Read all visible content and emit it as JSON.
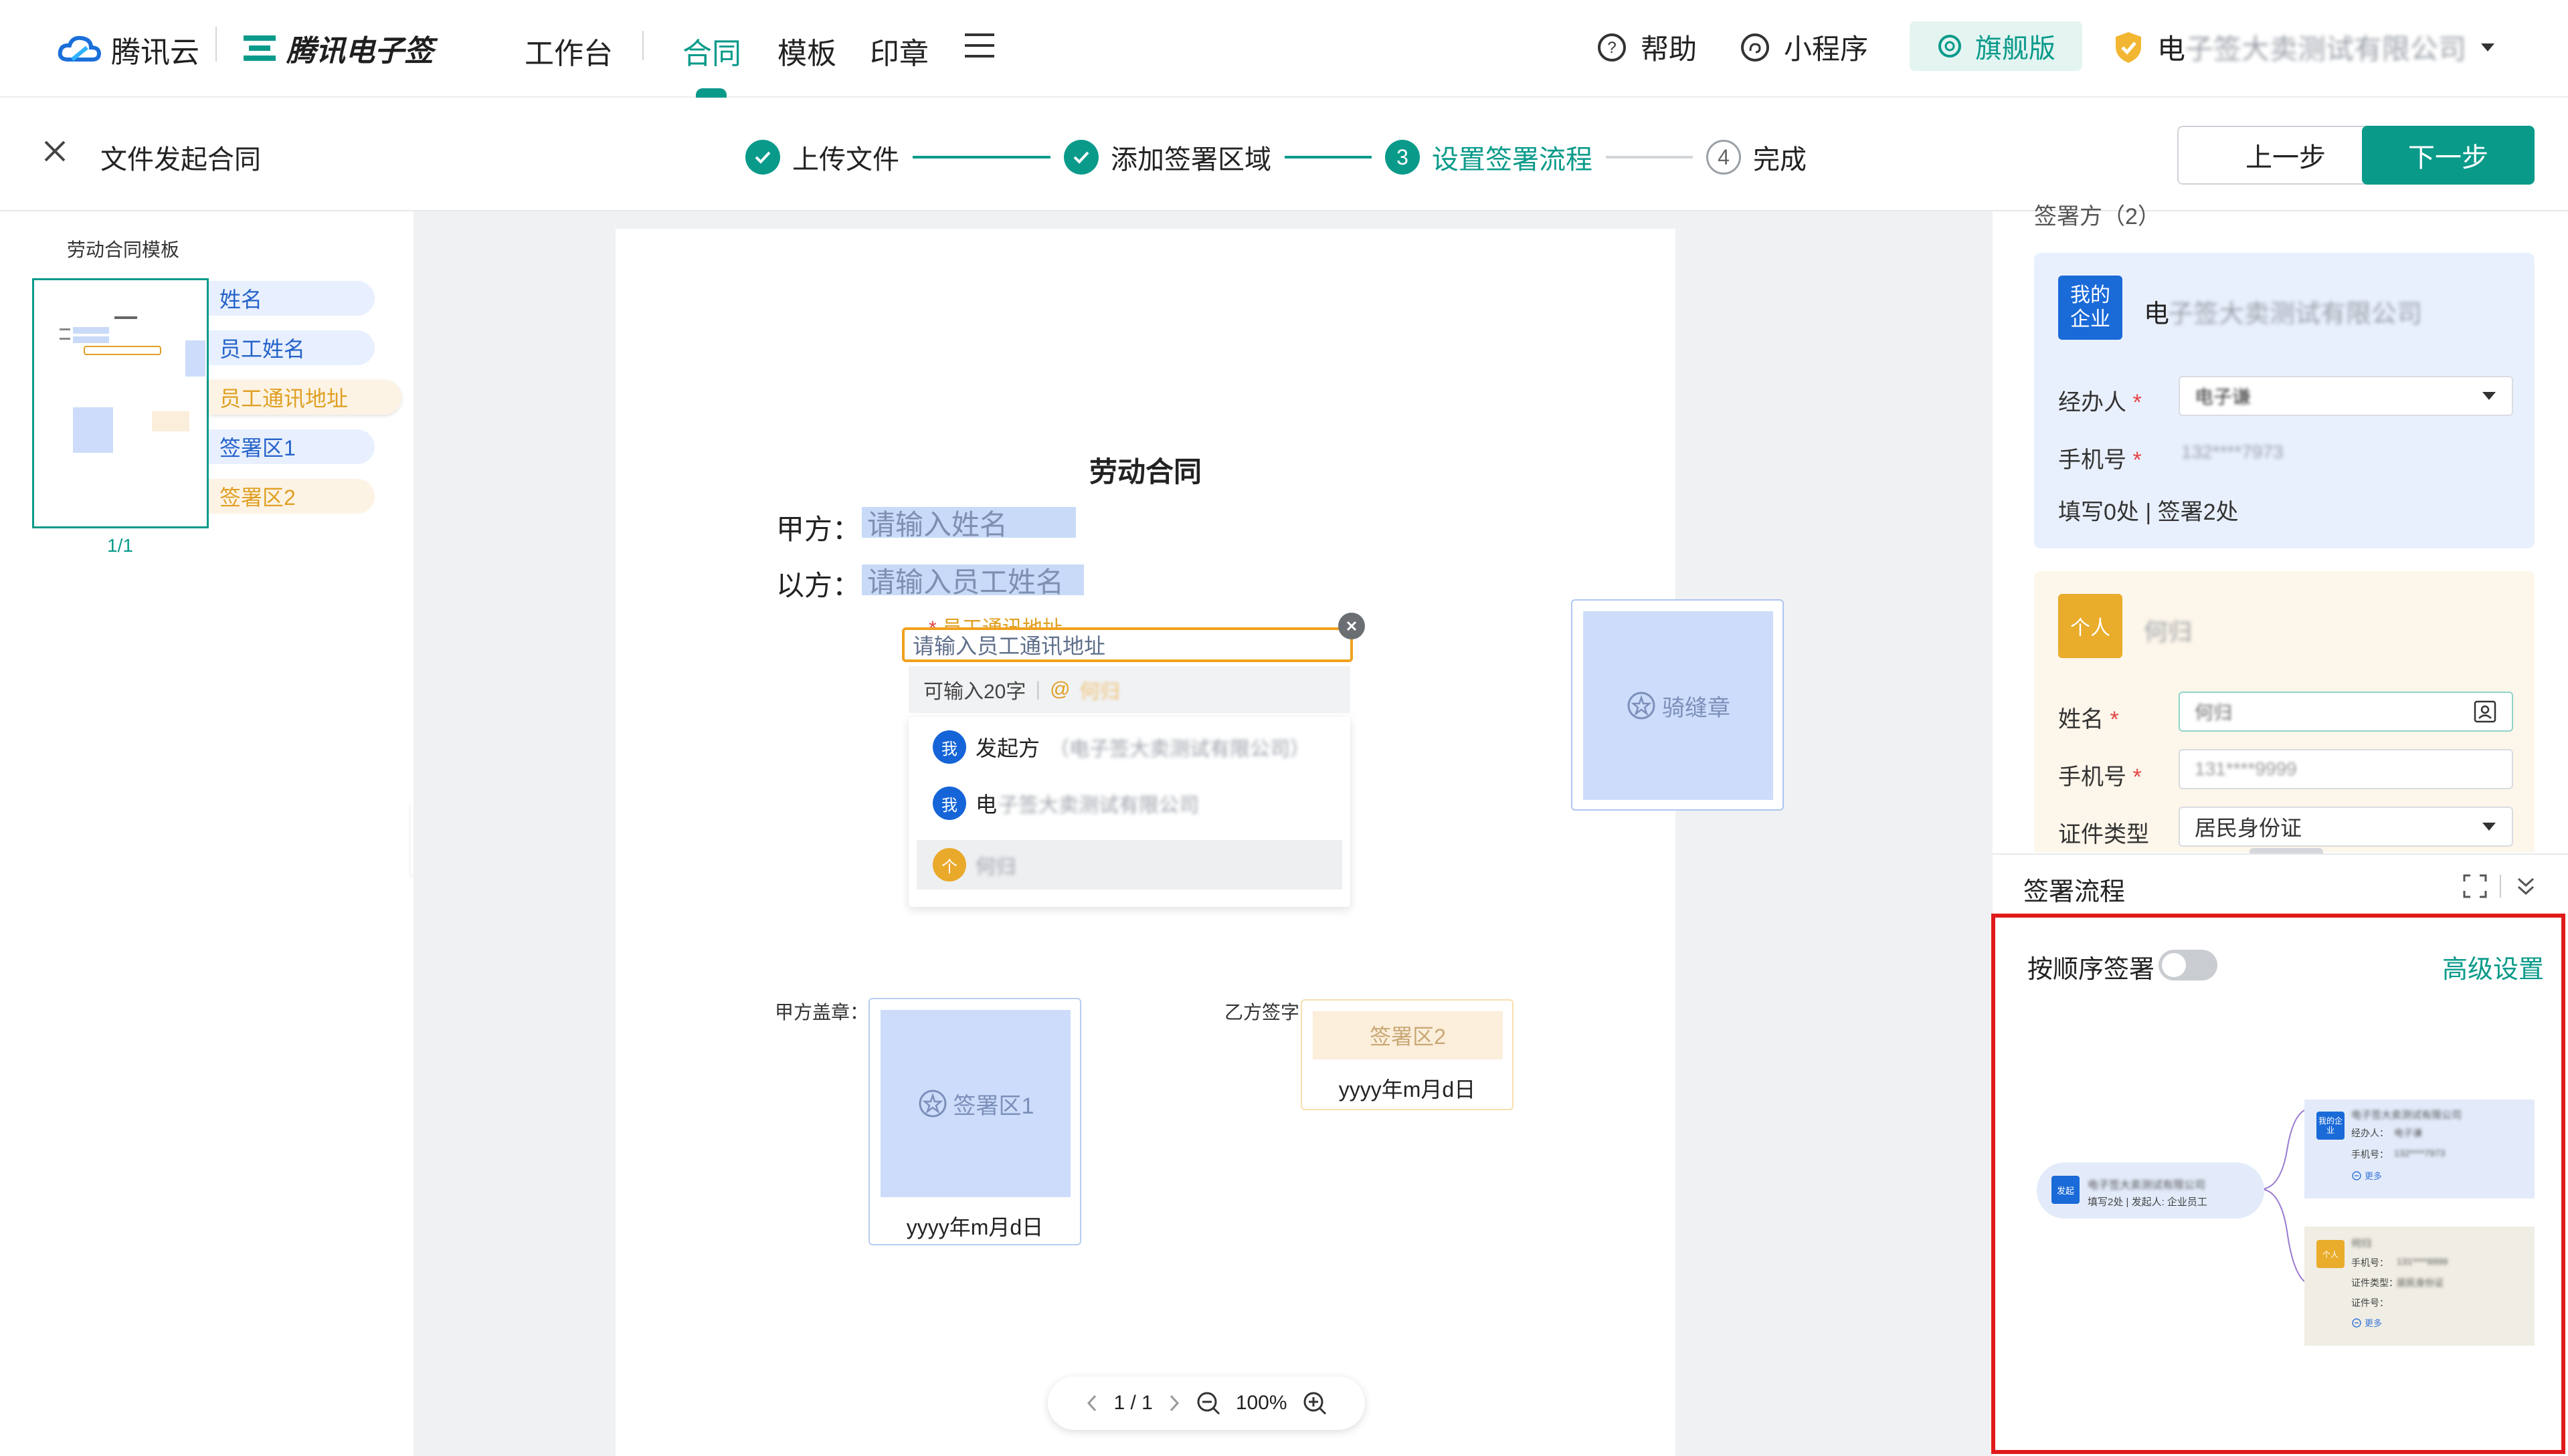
{
  "brand": {
    "tencent_cloud": "腾讯云",
    "esign": "腾讯电子签"
  },
  "nav": {
    "items": [
      "工作台",
      "合同",
      "模板",
      "印章"
    ],
    "active_index": 1
  },
  "topright": {
    "help": "帮助",
    "miniprogram": "小程序",
    "flagship": "旗舰版",
    "company_first_char": "电",
    "company_blurred": "子签大卖测试有限公司"
  },
  "header": {
    "close_title": "文件发起合同",
    "prev_btn": "上一步",
    "next_btn": "下一步"
  },
  "steps": [
    {
      "num": "",
      "label": "上传文件",
      "state": "done"
    },
    {
      "num": "",
      "label": "添加签署区域",
      "state": "done"
    },
    {
      "num": "3",
      "label": "设置签署流程",
      "state": "current"
    },
    {
      "num": "4",
      "label": "完成",
      "state": "todo"
    }
  ],
  "left": {
    "title": "劳动合同模板",
    "tags": [
      "姓名",
      "员工姓名",
      "员工通讯地址",
      "签署区1",
      "签署区2"
    ],
    "page_counter": "1/1"
  },
  "doc": {
    "title": "劳动合同",
    "party_a_label": "甲方：",
    "party_a_placeholder": "请输入姓名",
    "party_b_label": "以方：",
    "party_b_placeholder": "请输入员工姓名",
    "addr_field_label": "员工通讯地址",
    "addr_placeholder": "请输入员工通讯地址",
    "hint": "可输入20字",
    "hint_at": "@",
    "hint_at_name": "何归",
    "dropdown": [
      {
        "badge": "我",
        "text": "发起方",
        "sub": "（电子签大卖测试有限公司）"
      },
      {
        "badge": "我",
        "text": "电",
        "sub": "子签大卖测试有限公司"
      },
      {
        "badge": "个",
        "text": "",
        "sub": "何归"
      }
    ],
    "seam_stamp": "骑缝章",
    "stamp_a_label": "甲方盖章：",
    "stamp_a_area": "签署区1",
    "stamp_a_date": "yyyy年m月d日",
    "sign_b_label": "乙方签字：",
    "sign_b_area": "签署区2",
    "sign_b_date": "yyyy年m月d日"
  },
  "pager": {
    "page": "1 / 1",
    "zoom": "100%"
  },
  "signers": {
    "header": "签署方（2）",
    "company": {
      "badge": "我的\n企业",
      "name_first": "电",
      "name_blur": "子签大卖测试有限公司",
      "agent_label": "经办人",
      "agent_value": "电子谦",
      "phone_label": "手机号",
      "phone_value": "132****7973",
      "summary": "填写0处 | 签署2处"
    },
    "person": {
      "badge": "个人",
      "name": "何归",
      "name_label": "姓名",
      "name_value": "何归",
      "phone_label": "手机号",
      "phone_value": "131****9999",
      "id_type_label": "证件类型",
      "id_type_value": "居民身份证"
    }
  },
  "flow": {
    "title": "签署流程",
    "sequential_label": "按顺序签署",
    "sequential_on": false,
    "advanced": "高级设置",
    "mini": {
      "start_badge": "发起",
      "start_name": "电子签大卖测试有限公司",
      "start_sub": "填写2处 | 发起人: 企业员工",
      "company_badge": "我的企业",
      "company_name": "电子签大卖测试有限公司",
      "company_agent_label": "经办人：",
      "company_agent": "电子谦",
      "company_phone_label": "手机号：",
      "company_phone": "132****7973",
      "more": "更多",
      "person_badge": "个人",
      "person_name": "何归",
      "person_phone_label": "手机号：",
      "person_phone": "131****9999",
      "person_idtype_label": "证件类型：",
      "person_idtype": "居民身份证",
      "person_idno_label": "证件号：",
      "person_more": "更多"
    }
  },
  "colors": {
    "accent": "#0a9a8a",
    "blue": "#2563c9",
    "orange": "#e0a024",
    "highlight": "#e01a1a"
  }
}
